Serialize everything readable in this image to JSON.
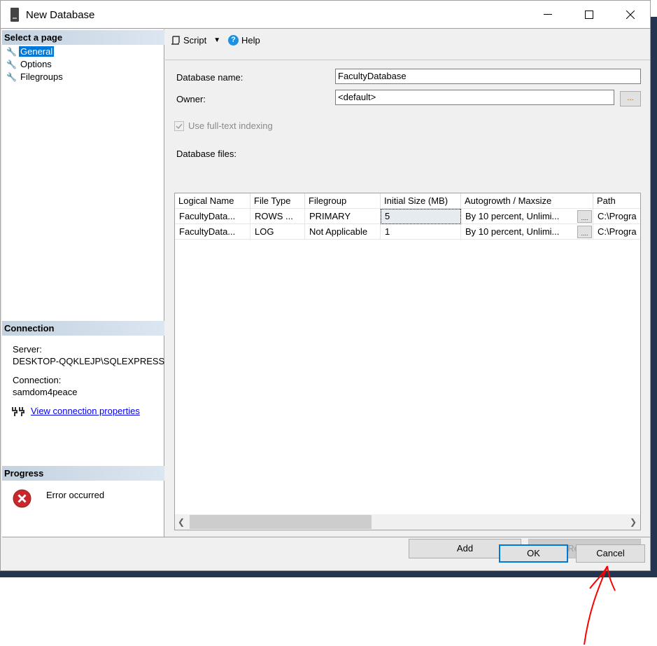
{
  "window": {
    "title": "New Database",
    "icon": "server-icon"
  },
  "left": {
    "select_header": "Select a page",
    "pages": [
      {
        "label": "General",
        "selected": true
      },
      {
        "label": "Options"
      },
      {
        "label": "Filegroups"
      }
    ],
    "connection_header": "Connection",
    "server_label": "Server:",
    "server_value": "DESKTOP-QQKLEJP\\SQLEXPRESS",
    "connection_label": "Connection:",
    "connection_value": "samdom4peace",
    "view_link": "View connection properties",
    "progress_header": "Progress",
    "progress_status": "Error occurred"
  },
  "toolbar": {
    "script": "Script",
    "help": "Help"
  },
  "form": {
    "db_name_label": "Database name:",
    "db_name_value": "FacultyDatabase",
    "owner_label": "Owner:",
    "owner_value": "<default>",
    "owner_browse": "...",
    "fulltext_label": "Use full-text indexing",
    "fulltext_checked": true,
    "files_label": "Database files:"
  },
  "grid": {
    "columns": [
      "Logical Name",
      "File Type",
      "Filegroup",
      "Initial Size (MB)",
      "Autogrowth / Maxsize",
      "Path"
    ],
    "rows": [
      [
        "FacultyData...",
        "ROWS ...",
        "PRIMARY",
        "5",
        "By 10 percent, Unlimi...",
        "C:\\Progra"
      ],
      [
        "FacultyData...",
        "LOG",
        "Not Applicable",
        "1",
        "By 10 percent, Unlimi...",
        "C:\\Progra"
      ]
    ],
    "cell_button": "...."
  },
  "buttons": {
    "add": "Add",
    "remove": "Remove",
    "ok": "OK",
    "cancel": "Cancel"
  },
  "colors": {
    "selection": "#0078d7",
    "annotation_arrow": "#ff0000",
    "error": "#c8282d"
  }
}
